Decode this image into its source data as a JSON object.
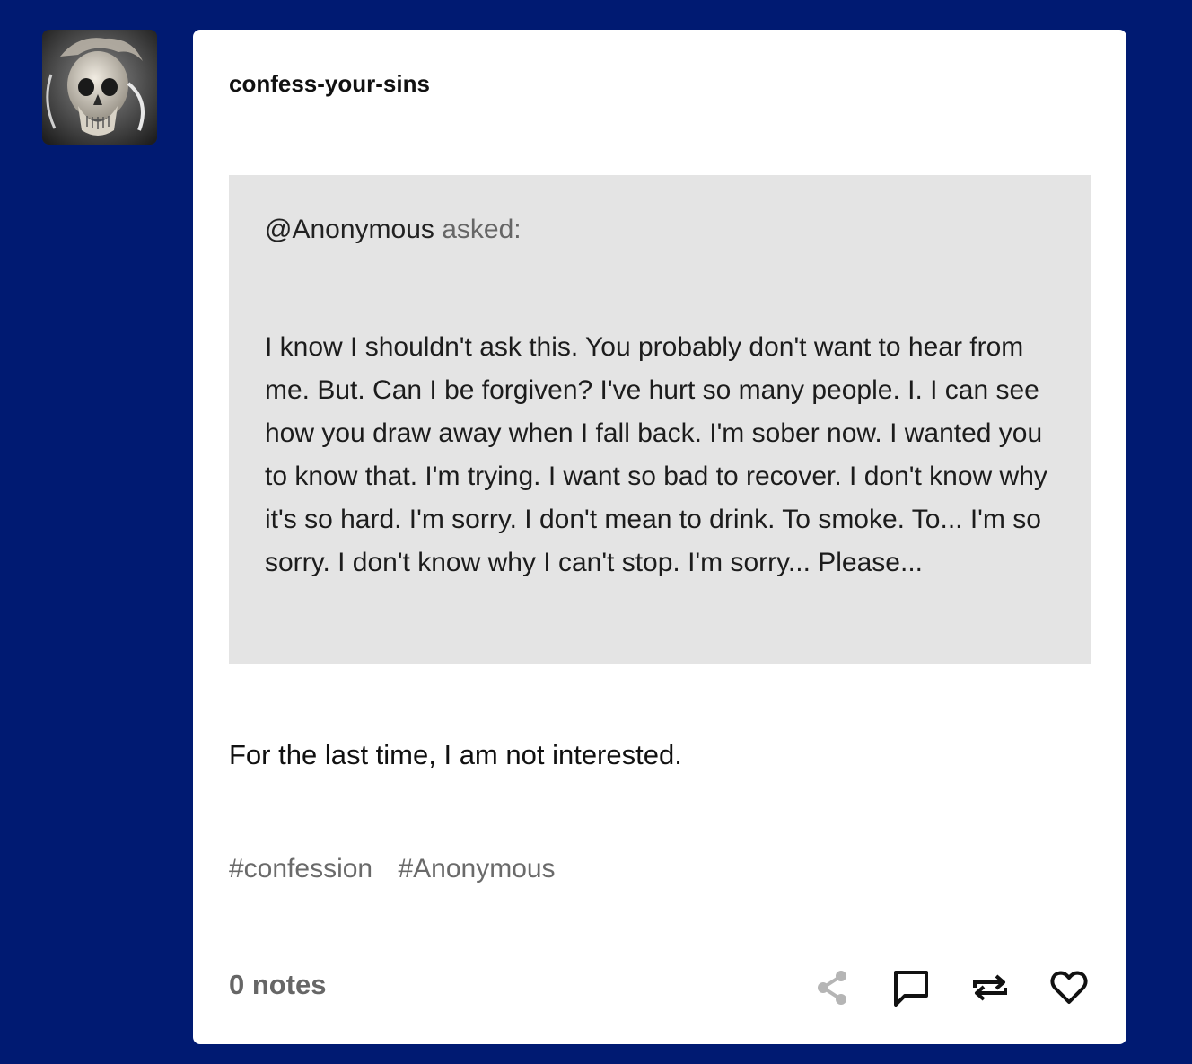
{
  "post": {
    "blog_name": "confess-your-sins",
    "avatar": "skull-avatar",
    "ask": {
      "asker": "@Anonymous",
      "asked_label": "asked:",
      "question": "I know I shouldn't ask this. You probably don't want to hear from me. But. Can I be forgiven? I've hurt so many people. I. I can see how you draw away when I fall back. I'm sober now. I wanted you to know that. I'm trying. I want so bad to recover. I don't know why it's so hard. I'm sorry. I don't mean to drink. To smoke. To... I'm so sorry. I don't know why I can't stop. I'm sorry... Please..."
    },
    "answer": "For the last time, I am not interested.",
    "tags": [
      "#confession",
      "#Anonymous"
    ],
    "notes": "0 notes",
    "actions": {
      "share": "share-icon",
      "reply": "reply-icon",
      "reblog": "reblog-icon",
      "like": "heart-icon"
    }
  },
  "colors": {
    "background": "#001a72",
    "card": "#ffffff",
    "ask_box": "#e4e4e4",
    "muted_text": "#666666"
  }
}
